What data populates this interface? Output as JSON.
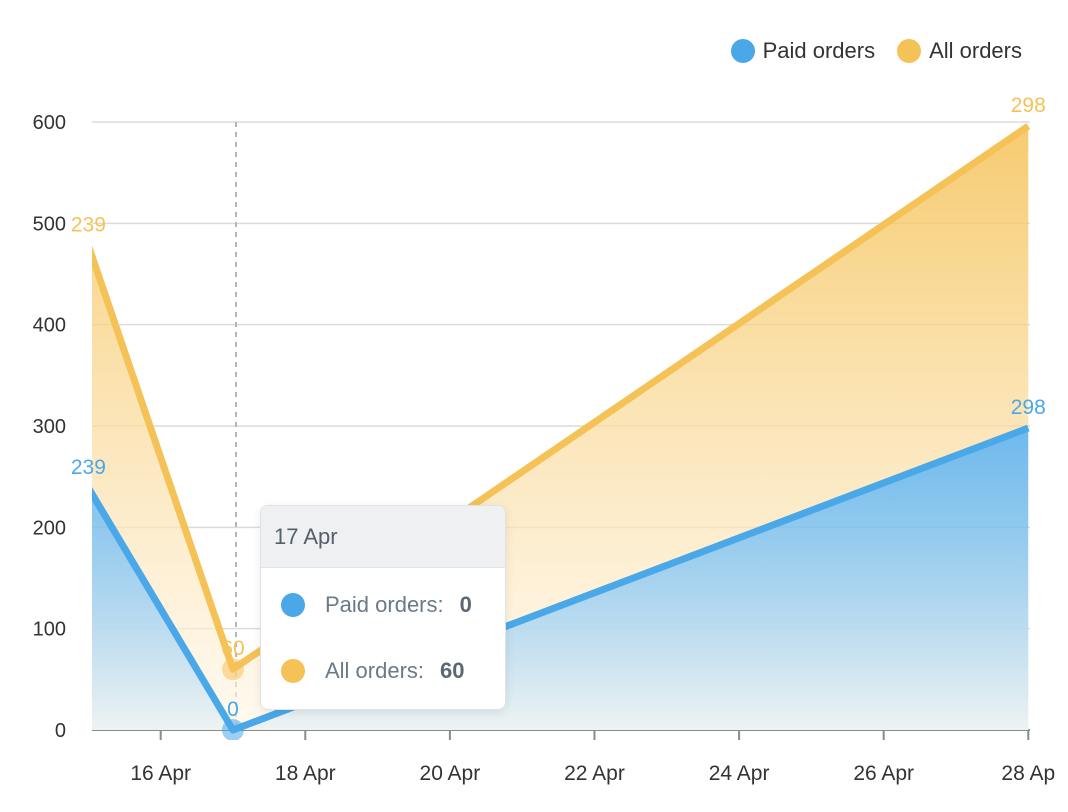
{
  "chart_data": {
    "type": "area",
    "x": [
      "15 Apr",
      "17 Apr",
      "28 Apr"
    ],
    "x_days": [
      15,
      17,
      28
    ],
    "x_tick_labels": [
      "16 Apr",
      "18 Apr",
      "20 Apr",
      "22 Apr",
      "24 Apr",
      "26 Apr",
      "28 Ap"
    ],
    "x_tick_days": [
      16,
      18,
      20,
      22,
      24,
      26,
      28
    ],
    "y_tick_labels": [
      "0",
      "100",
      "200",
      "300",
      "400",
      "500",
      "600"
    ],
    "ylim": [
      0,
      600
    ],
    "grid": true,
    "legend_position": "top-right",
    "series": [
      {
        "name": "Paid orders",
        "values": [
          239,
          0,
          298
        ],
        "stacked_totals": [
          239,
          0,
          298
        ],
        "labels": [
          "239",
          "0",
          "298"
        ],
        "color": "#4aa8e8"
      },
      {
        "name": "All orders",
        "values": [
          239,
          60,
          298
        ],
        "stacked_totals": [
          478,
          60,
          596
        ],
        "labels": [
          "239",
          "60",
          "298"
        ],
        "color": "#f5c257"
      }
    ]
  },
  "tooltip": {
    "title": "17 Apr",
    "rows": [
      {
        "label": "Paid orders:",
        "value": "0",
        "color": "#4aa8e8"
      },
      {
        "label": "All orders:",
        "value": "60",
        "color": "#f5c257"
      }
    ]
  }
}
